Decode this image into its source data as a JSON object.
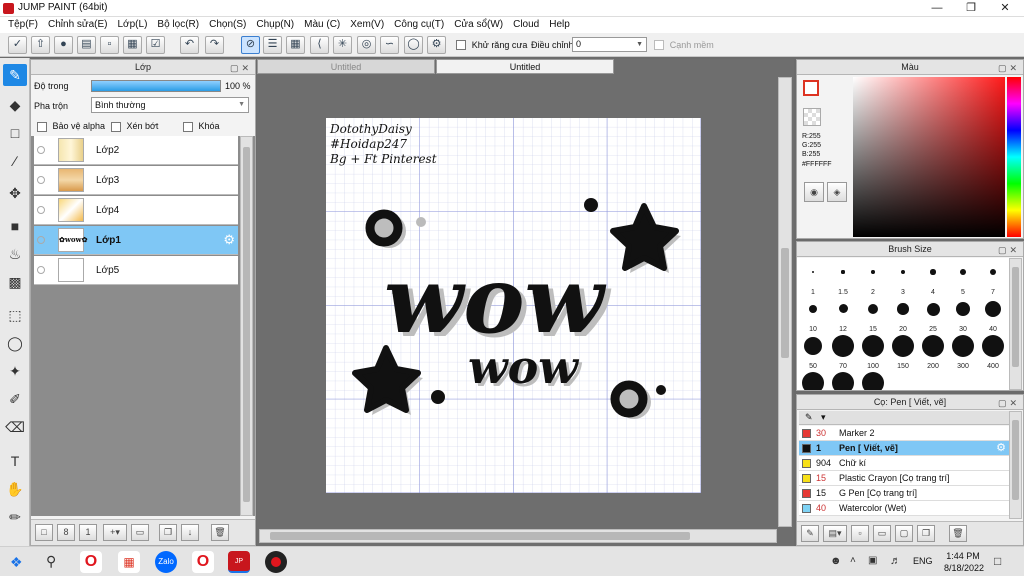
{
  "window": {
    "title": "JUMP PAINT (64bit)"
  },
  "menu": [
    "Tệp(F)",
    "Chỉnh sửa(E)",
    "Lớp(L)",
    "Bộ lọc(R)",
    "Chọn(S)",
    "Chụp(N)",
    "Màu (C)",
    "Xem(V)",
    "Công cụ(T)",
    "Cửa sổ(W)",
    "Cloud",
    "Help"
  ],
  "toolbar": {
    "antialias_label": "Khử răng cưa",
    "adjust_label": "Điều chỉnh",
    "adjust_value": "0",
    "snap_label": "Cạnh mềm"
  },
  "layer_panel": {
    "title": "Lớp",
    "opacity_label": "Độ trong",
    "opacity_value": "100 %",
    "opacity_fraction": 1.0,
    "blend_label": "Pha trộn",
    "blend_value": "Bình thường",
    "protect_alpha": "Bảo vệ alpha",
    "clip": "Xén bớt",
    "lock": "Khóa",
    "layers": [
      {
        "name": "Lớp2",
        "selected": false
      },
      {
        "name": "Lớp3",
        "selected": false
      },
      {
        "name": "Lớp4",
        "selected": false
      },
      {
        "name": "Lớp1",
        "selected": true
      },
      {
        "name": "Lớp5",
        "selected": false
      }
    ]
  },
  "documents": {
    "tabs": [
      "Untitled",
      "Untitled"
    ],
    "active_tab": 1
  },
  "artwork": {
    "credit_lines": [
      "DotothyDaisy",
      "#Hoidap247",
      "Bg + Ft Pinterest"
    ],
    "big_text": "wow",
    "small_text": "wow"
  },
  "color_panel": {
    "title": "Màu",
    "r": "R:255",
    "g": "G:255",
    "b": "B:255",
    "hex": "#FFFFFF",
    "foreground": "#ffffff"
  },
  "brush_panel": {
    "title": "Brush Size",
    "sizes": [
      "1",
      "1.5",
      "2",
      "3",
      "4",
      "5",
      "7",
      "10",
      "12",
      "15",
      "20",
      "25",
      "30",
      "40",
      "50",
      "70",
      "100",
      "150",
      "200",
      "300",
      "400",
      "",
      "",
      ""
    ]
  },
  "subtool_panel": {
    "title": "Cọ: Pen [ Viết, vẽ]",
    "items": [
      {
        "size": "30",
        "name": "Marker 2",
        "color": "#e53935",
        "selected": false
      },
      {
        "size": "1",
        "name": "Pen [ Viết, vẽ]",
        "color": "#111111",
        "selected": true
      },
      {
        "size": "904",
        "name": "Chữ kí",
        "color": "#f7e018",
        "selected": false
      },
      {
        "size": "15",
        "name": "Plastic Crayon [Cọ trang trí]",
        "color": "#f7e018",
        "selected": false
      },
      {
        "size": "15",
        "name": "G Pen [Cọ trang trí]",
        "color": "#e53935",
        "selected": false
      },
      {
        "size": "40",
        "name": "Watercolor (Wet)",
        "color": "#7fd3f5",
        "selected": false
      }
    ]
  },
  "taskbar": {
    "time": "1:44 PM",
    "date": "8/18/2022",
    "lang": "ENG"
  }
}
